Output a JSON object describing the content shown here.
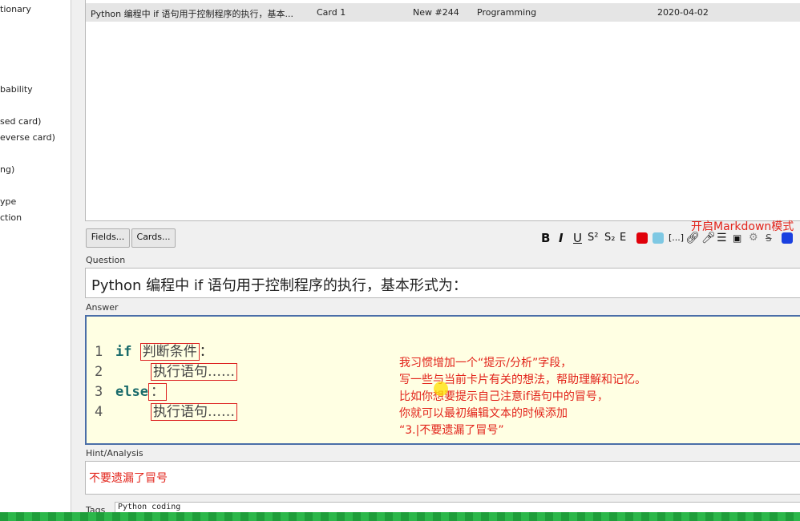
{
  "sidebar": {
    "items": [
      "tionary",
      "bability",
      "sed card)",
      "everse card)",
      "ng)",
      "ype",
      "ction"
    ]
  },
  "card_list": {
    "rows": [
      {
        "sort_field": "Python 编程中 if 语句用于控制程序的执行，基本...",
        "card": "Card 1",
        "due": "New #244",
        "deck": "Programming",
        "date": "2020-04-02"
      }
    ]
  },
  "buttons": {
    "fields": "Fields...",
    "cards": "Cards..."
  },
  "toolbar": {
    "bold": "B",
    "italic": "I",
    "underline": "U",
    "superscript": "S²",
    "subscript": "S₂",
    "clear_format": "E",
    "text_color": "#e0000a",
    "highlight_color": "#7ec8e3",
    "cloze": "[...]",
    "markdown_color": "#1a40e0"
  },
  "markdown_annotation": "开启Markdown模式",
  "question": {
    "label": "Question",
    "value": "Python 编程中 if 语句用于控制程序的执行，基本形式为："
  },
  "answer": {
    "label": "Answer",
    "lines": [
      {
        "num": "1",
        "kw": "if",
        "text": "判断条件",
        "end": "："
      },
      {
        "num": "2",
        "kw": "",
        "text": "执行语句……",
        "end": ""
      },
      {
        "num": "3",
        "kw": "else",
        "text": "",
        "end": "："
      },
      {
        "num": "4",
        "kw": "",
        "text": "执行语句……",
        "end": ""
      }
    ],
    "note": [
      "我习惯增加一个“提示/分析”字段，",
      "写一些与当前卡片有关的想法，帮助理解和记忆。",
      "比如你想要提示自己注意if语句中的冒号，",
      "你就可以最初编辑文本的时候添加",
      "“3.|不要遗漏了冒号”"
    ]
  },
  "hint": {
    "label": "Hint/Analysis",
    "value": "不要遗漏了冒号"
  },
  "tags": {
    "label": "Tags",
    "value": "Python coding"
  }
}
